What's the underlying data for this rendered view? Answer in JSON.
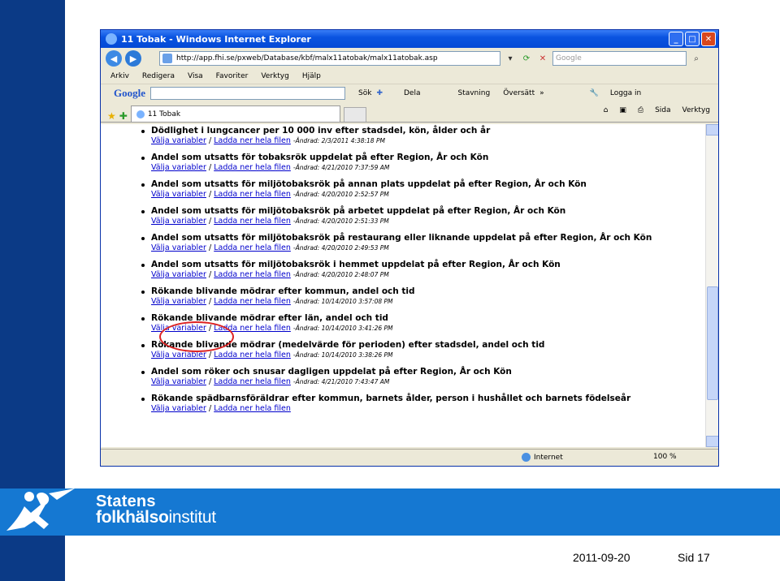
{
  "window": {
    "title": "11 Tobak - Windows Internet Explorer",
    "address": "http://app.fhi.se/pxweb/Database/kbf/malx11atobak/malx11atobak.asp",
    "search_placeholder": "Google",
    "menu": [
      "Arkiv",
      "Redigera",
      "Visa",
      "Favoriter",
      "Verktyg",
      "Hjälp"
    ],
    "google_toolbar": {
      "logo": "Google",
      "items": [
        "Sök",
        "Dela",
        "Stavning",
        "Översätt",
        "Logga in"
      ]
    },
    "tab_label": "11 Tobak",
    "tab_tools": [
      "Sida",
      "Verktyg"
    ],
    "status": {
      "zone": "Internet",
      "zoom": "100 %"
    }
  },
  "links_label": {
    "choose": "Välja variabler",
    "download": "Ladda ner hela filen",
    "sep": "/"
  },
  "items": [
    {
      "title": "Dödlighet i lungcancer per 10 000 inv efter stadsdel, kön, ålder och år",
      "changed": "-Ändrad: 2/3/2011 4:38:18 PM"
    },
    {
      "title": "Andel som utsatts för tobaksrök uppdelat på efter Region, År och Kön",
      "changed": "-Ändrad: 4/21/2010 7:37:59 AM"
    },
    {
      "title": "Andel som utsatts för miljötobaksrök på annan plats uppdelat på efter Region, År och Kön",
      "changed": "-Ändrad: 4/20/2010 2:52:57 PM"
    },
    {
      "title": "Andel som utsatts för miljötobaksrök på arbetet uppdelat på efter Region, År och Kön",
      "changed": "-Ändrad: 4/20/2010 2:51:33 PM"
    },
    {
      "title": "Andel som utsatts för miljötobaksrök på restaurang eller liknande uppdelat på efter Region, År och Kön",
      "changed": "-Ändrad: 4/20/2010 2:49:53 PM"
    },
    {
      "title": "Andel som utsatts för miljötobaksrök i hemmet uppdelat på efter Region, År och Kön",
      "changed": "-Ändrad: 4/20/2010 2:48:07 PM"
    },
    {
      "title": "Rökande blivande mödrar efter kommun, andel och tid",
      "changed": "-Ändrad: 10/14/2010 3:57:08 PM"
    },
    {
      "title": "Rökande blivande mödrar efter län, andel och tid",
      "changed": "-Ändrad: 10/14/2010 3:41:26 PM"
    },
    {
      "title": "Rökande blivande mödrar (medelvärde för perioden) efter stadsdel, andel och tid",
      "changed": "-Ändrad: 10/14/2010 3:38:26 PM"
    },
    {
      "title": "Andel som röker och snusar dagligen uppdelat på efter Region, År och Kön",
      "changed": "-Ändrad: 4/21/2010 7:43:47 AM"
    },
    {
      "title": "Rökande spädbarnsföräldrar efter kommun, barnets ålder, person i hushållet och barnets födelseår",
      "changed": ""
    }
  ],
  "logo": {
    "line1": "Statens",
    "line2_bold": "folkhälso",
    "line2_rest": "institut"
  },
  "footer": {
    "date": "2011-09-20",
    "page": "Sid 17"
  },
  "colors": {
    "sidebar": "#0b3a86",
    "bar": "#1578d2",
    "link": "#0000cc",
    "highlight": "#dd2222"
  }
}
